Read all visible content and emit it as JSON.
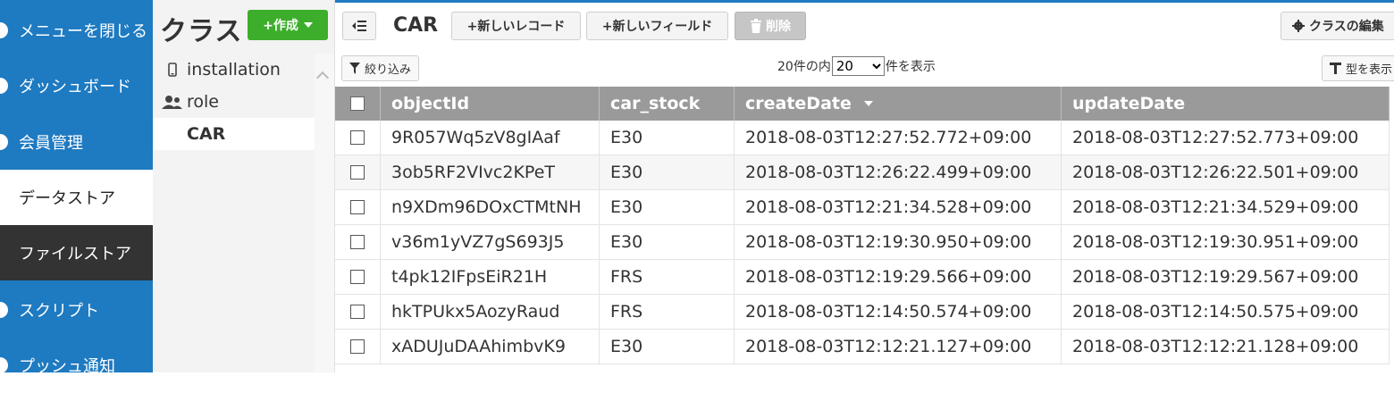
{
  "nav": {
    "items": [
      {
        "label": "メニューを閉じる"
      },
      {
        "label": "ダッシュボード"
      },
      {
        "label": "会員管理"
      },
      {
        "label": "データストア"
      },
      {
        "label": "ファイルストア"
      },
      {
        "label": "スクリプト"
      },
      {
        "label": "プッシュ通知"
      }
    ]
  },
  "classes": {
    "title": "クラス",
    "create_label": "+作成",
    "items": [
      {
        "label": "installation",
        "icon": "mobile-icon"
      },
      {
        "label": "role",
        "icon": "users-icon"
      },
      {
        "label": "CAR",
        "icon": ""
      }
    ]
  },
  "toolbar": {
    "title": "CAR",
    "new_record": "+新しいレコード",
    "new_field": "+新しいフィールド",
    "delete": "削除",
    "class_edit": "クラスの編集"
  },
  "filterbar": {
    "filter": "絞り込み",
    "paging_prefix": "20件の内",
    "page_size": "20",
    "paging_suffix": "件を表示",
    "type_display": "型を表示"
  },
  "table": {
    "columns": [
      "objectId",
      "car_stock",
      "createDate",
      "updateDate"
    ],
    "rows": [
      [
        "9R057Wq5zV8gIAaf",
        "E30",
        "2018-08-03T12:27:52.772+09:00",
        "2018-08-03T12:27:52.773+09:00"
      ],
      [
        "3ob5RF2VIvc2KPeT",
        "E30",
        "2018-08-03T12:26:22.499+09:00",
        "2018-08-03T12:26:22.501+09:00"
      ],
      [
        "n9XDm96DOxCTMtNH",
        "E30",
        "2018-08-03T12:21:34.528+09:00",
        "2018-08-03T12:21:34.529+09:00"
      ],
      [
        "v36m1yVZ7gS693J5",
        "E30",
        "2018-08-03T12:19:30.950+09:00",
        "2018-08-03T12:19:30.951+09:00"
      ],
      [
        "t4pk12IFpsEiR21H",
        "FRS",
        "2018-08-03T12:19:29.566+09:00",
        "2018-08-03T12:19:29.567+09:00"
      ],
      [
        "hkTPUkx5AozyRaud",
        "FRS",
        "2018-08-03T12:14:50.574+09:00",
        "2018-08-03T12:14:50.575+09:00"
      ],
      [
        "xADUJuDAAhimbvK9",
        "E30",
        "2018-08-03T12:12:21.127+09:00",
        "2018-08-03T12:12:21.128+09:00"
      ]
    ]
  },
  "colors": {
    "nav_bg": "#1e7ac1",
    "create_btn": "#3dae2b",
    "table_header": "#9a9a9a"
  }
}
